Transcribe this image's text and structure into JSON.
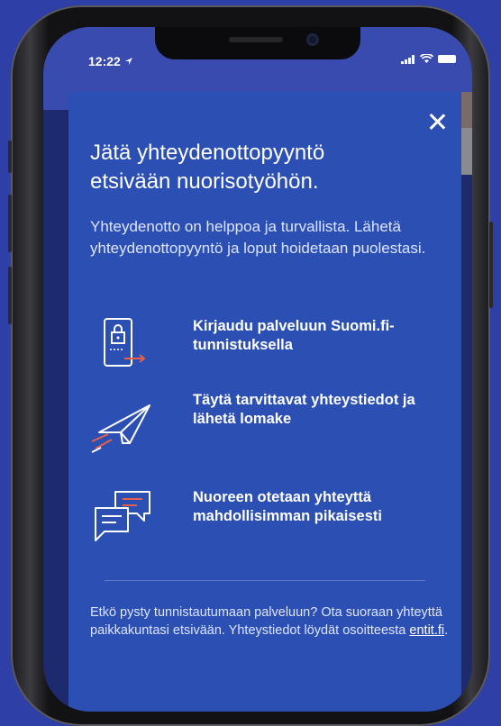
{
  "status_bar": {
    "time": "12:22"
  },
  "modal": {
    "title": "Jätä yhteydenottopyyntö etsivään nuorisotyöhön.",
    "intro": "Yhteydenotto on helppoa ja turvallista. Lähetä yhteydenottopyyntö ja loput hoidetaan puolestasi.",
    "steps": [
      {
        "icon": "phone-lock-login-icon",
        "text": "Kirjaudu palveluun Suomi.fi-tunnistuksella"
      },
      {
        "icon": "paper-plane-icon",
        "text": "Täytä tarvittavat yhteystiedot ja lähetä lomake"
      },
      {
        "icon": "chat-bubbles-icon",
        "text": "Nuoreen otetaan yhteyttä mahdollisimman pikaisesti"
      }
    ],
    "footer_text": "Etkö pysty tunnistautumaan palveluun? Ota suoraan yhteyttä paikkakuntasi etsivään. Yhteystiedot löydät osoitteesta ",
    "footer_link": "entit.fi",
    "footer_end": "."
  },
  "colors": {
    "background": "#2f3fa8",
    "modal": "#2c4fb3",
    "accent": "#e8604a"
  }
}
